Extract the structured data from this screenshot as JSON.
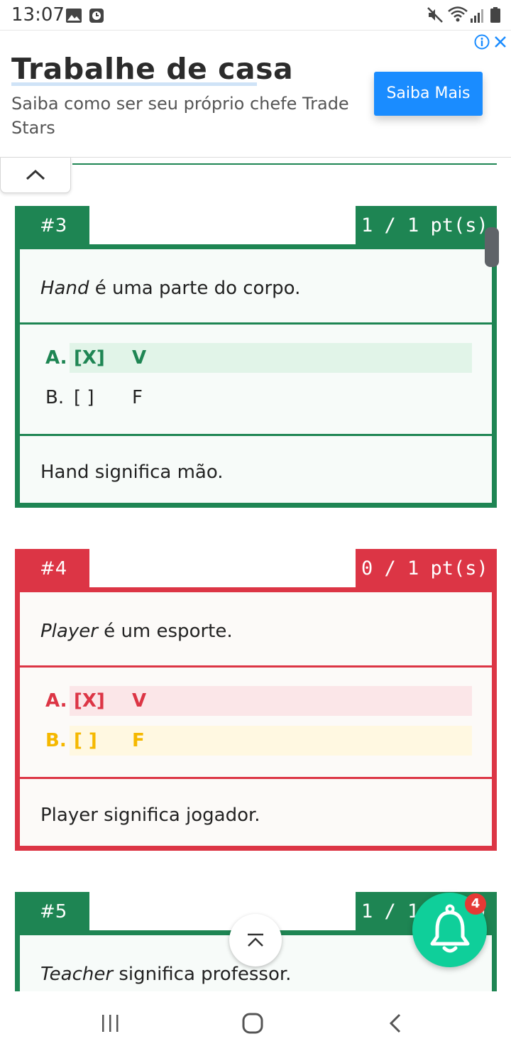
{
  "status_bar": {
    "time": "13:07",
    "left_icons": [
      "image-icon",
      "clock-icon"
    ],
    "right_icons": [
      "mute-icon",
      "wifi-icon",
      "signal-icon",
      "battery-icon"
    ]
  },
  "ad": {
    "title": "Trabalhe de casa",
    "description": "Saiba como ser seu próprio chefe Trade Stars",
    "button_label": "Saiba Mais",
    "accent_color": "#1a8cff"
  },
  "collapse_tab": {
    "icon": "chevron-up-icon"
  },
  "colors": {
    "correct": "#1e8553",
    "incorrect": "#dc3545",
    "warning": "#f5b800"
  },
  "questions": [
    {
      "number": "#3",
      "points": "1 / 1 pt(s)",
      "status": "correct",
      "statement_italic": "Hand",
      "statement_rest": " é uma parte do corpo.",
      "options": [
        {
          "letter": "A.",
          "box": "[X]",
          "value": "V",
          "state": "selected-correct"
        },
        {
          "letter": "B.",
          "box": "[ ]",
          "value": "F",
          "state": "neutral"
        }
      ],
      "feedback": "Hand significa mão."
    },
    {
      "number": "#4",
      "points": "0 / 1 pt(s)",
      "status": "incorrect",
      "statement_italic": "Player",
      "statement_rest": " é um esporte.",
      "options": [
        {
          "letter": "A.",
          "box": "[X]",
          "value": "V",
          "state": "selected-wrong"
        },
        {
          "letter": "B.",
          "box": "[ ]",
          "value": "F",
          "state": "missed-correct"
        }
      ],
      "feedback": "Player significa jogador."
    },
    {
      "number": "#5",
      "points": "1 / 1 pt(s)",
      "status": "correct",
      "statement_italic": "Teacher",
      "statement_rest": " significa professor."
    }
  ],
  "scroll_top": {
    "icon": "scroll-to-top-icon"
  },
  "notifications": {
    "icon": "bell-icon",
    "count": "4"
  },
  "nav_bar": {
    "icons": [
      "recent-apps-icon",
      "home-icon",
      "back-icon"
    ]
  }
}
